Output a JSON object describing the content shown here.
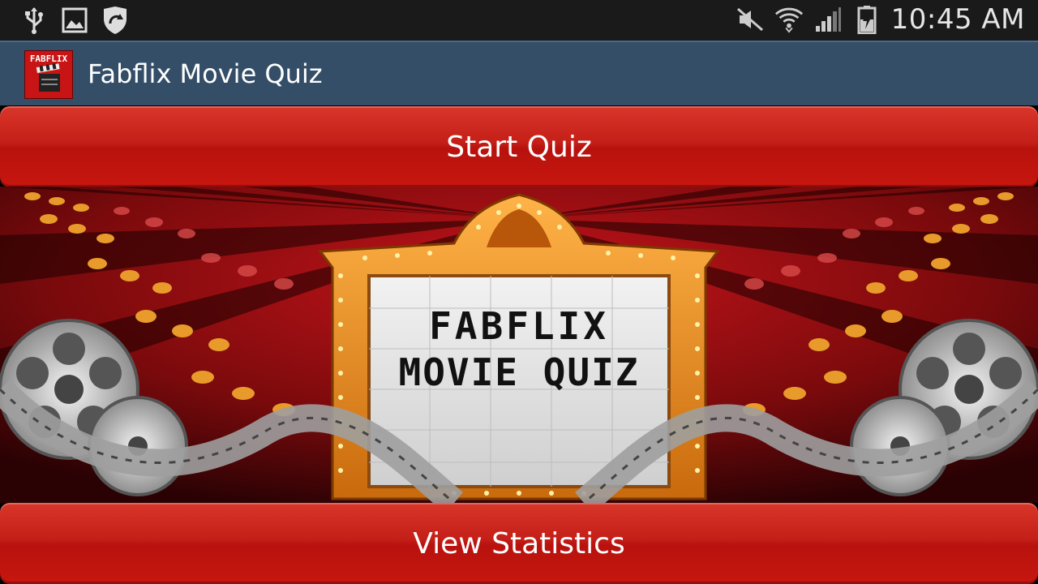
{
  "status_bar": {
    "time": "10:45 AM",
    "icons": [
      "usb-icon",
      "image-icon",
      "shield-sync-icon",
      "mute-icon",
      "wifi-icon",
      "signal-icon",
      "battery-charging-icon"
    ]
  },
  "action_bar": {
    "app_icon_text": "FABFLIX",
    "title": "Fabflix Movie Quiz"
  },
  "buttons": {
    "start_quiz": "Start Quiz",
    "view_statistics": "View Statistics"
  },
  "hero": {
    "marquee_line1": "FABFLIX",
    "marquee_line2": "MOVIE QUIZ"
  },
  "colors": {
    "status_bar": "#1a1a1a",
    "action_bar": "#344e68",
    "button_red": "#c41f18",
    "marquee_gold": "#e08a1e"
  }
}
